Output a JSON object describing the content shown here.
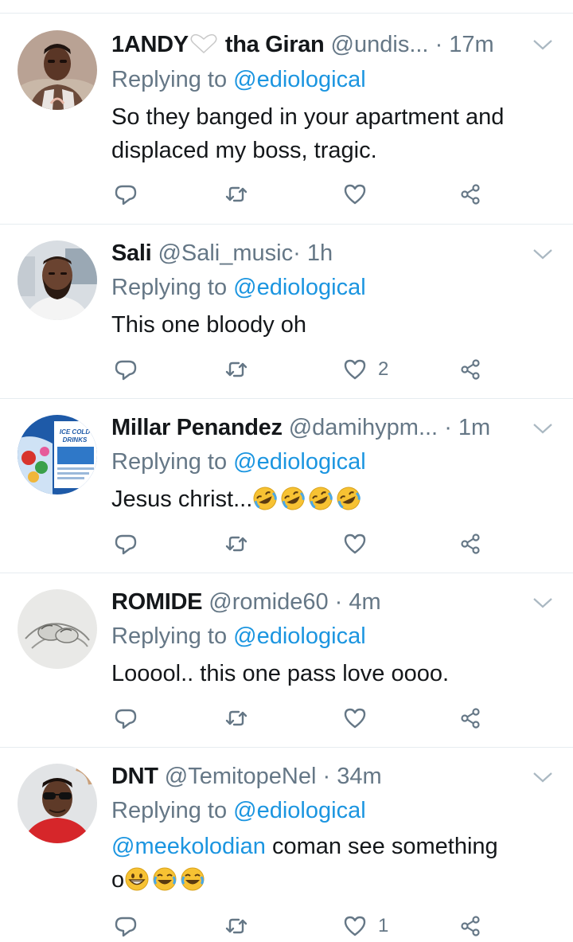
{
  "tweets": [
    {
      "name": "1ANDY",
      "name_suffix": "tha Giran",
      "name_emoji": "white-heart",
      "handle": "@undis...",
      "separator": "·",
      "time": "17m",
      "reply_prefix": "Replying to",
      "reply_to": "@ediological",
      "body_lines": [
        "So they banged in your apartment and",
        "displaced my boss, tragic."
      ],
      "likes": ""
    },
    {
      "name": "Sali",
      "handle": "@Sali_music",
      "separator": "·",
      "time": "1h",
      "reply_prefix": "Replying to",
      "reply_to": "@ediological",
      "body_lines": [
        "This one bloody oh"
      ],
      "likes": "2"
    },
    {
      "name": "Millar Penandez",
      "handle": "@damihypm...",
      "separator": "·",
      "time": "1m",
      "reply_prefix": "Replying to",
      "reply_to": "@ediological",
      "body_text": "Jesus christ...",
      "body_emojis": [
        "rofl",
        "rofl",
        "rofl",
        "rofl"
      ],
      "avatar_text": [
        "ICE COLD",
        "DRINKS"
      ],
      "likes": ""
    },
    {
      "name": "ROMIDE",
      "handle": "@romide60",
      "separator": "·",
      "time": "4m",
      "reply_prefix": "Replying to",
      "reply_to": "@ediological",
      "body_lines": [
        "Looool.. this one pass love oooo."
      ],
      "likes": ""
    },
    {
      "name": "DNT",
      "handle": "@TemitopeNel",
      "separator": "·",
      "time": "34m",
      "reply_prefix": "Replying to",
      "reply_to": "@ediological",
      "body_mention": "@meekolodian",
      "body_text": "coman see something",
      "body_text2": "o",
      "body_emojis": [
        "grin",
        "tears-of-joy",
        "tears-of-joy"
      ],
      "likes": "1"
    }
  ],
  "icons": {
    "reply": "reply-icon",
    "retweet": "retweet-icon",
    "like": "heart-icon",
    "share": "share-icon",
    "more": "chevron-down-icon"
  },
  "colors": {
    "text": "#14171a",
    "muted": "#657786",
    "link": "#1b95e0",
    "divider": "#e6ecf0"
  }
}
